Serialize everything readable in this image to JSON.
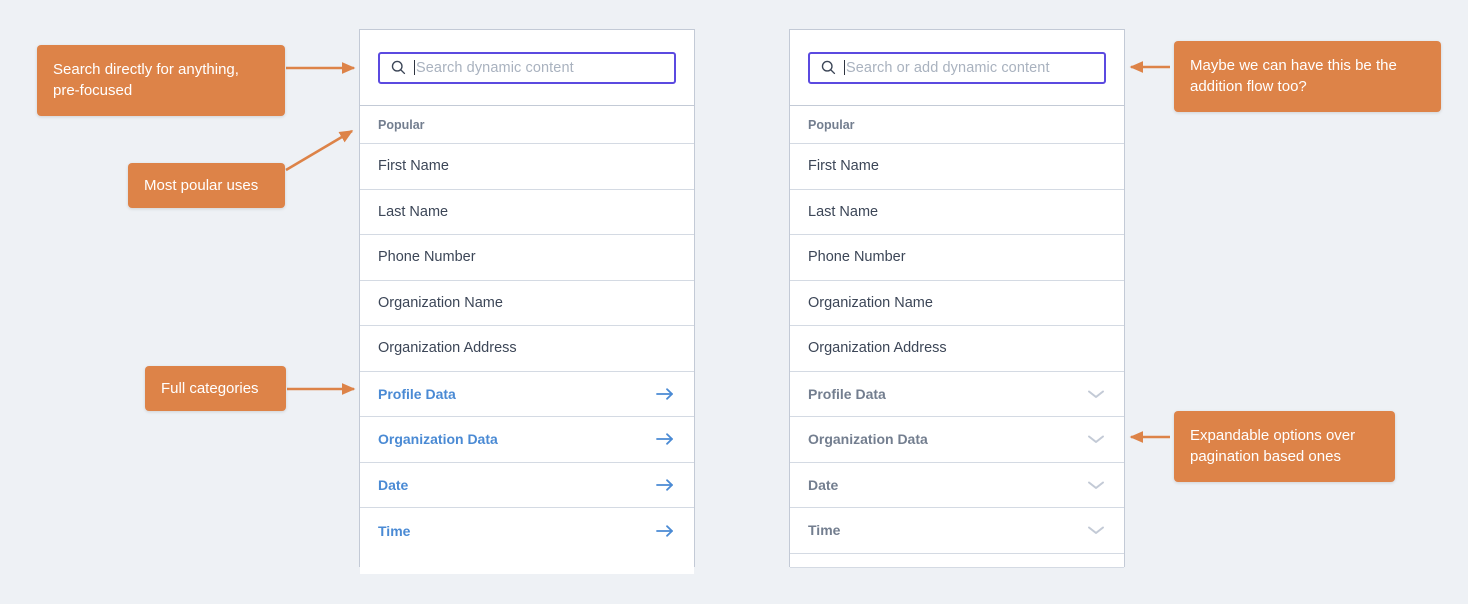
{
  "background_color": "#eef1f5",
  "accent_colors": {
    "note_background": "#dd8348",
    "note_text": "#ffffff",
    "search_border_focus": "#5b4ae0",
    "category_link": "#4a8ad4",
    "category_plain": "#737e8f",
    "row_text": "#3c4657",
    "panel_border": "#c3cad6",
    "chevron": "#c3cad6"
  },
  "panels": [
    {
      "id": "left",
      "search": {
        "icon": "search-icon",
        "placeholder": "Search dynamic content",
        "value": "",
        "focused": true,
        "caret_visible": true
      },
      "section_label": "Popular",
      "popular_items": [
        {
          "label": "First Name"
        },
        {
          "label": "Last Name"
        },
        {
          "label": "Phone Number"
        },
        {
          "label": "Organization Name"
        },
        {
          "label": "Organization Address"
        }
      ],
      "category_items": [
        {
          "label": "Profile Data",
          "icon": "arrow-right-icon"
        },
        {
          "label": "Organization Data",
          "icon": "arrow-right-icon"
        },
        {
          "label": "Date",
          "icon": "arrow-right-icon"
        },
        {
          "label": "Time",
          "icon": "arrow-right-icon"
        }
      ]
    },
    {
      "id": "right",
      "search": {
        "icon": "search-icon",
        "placeholder": "Search or add dynamic content",
        "value": "",
        "focused": true,
        "caret_visible": true
      },
      "section_label": "Popular",
      "popular_items": [
        {
          "label": "First Name"
        },
        {
          "label": "Last Name"
        },
        {
          "label": "Phone Number"
        },
        {
          "label": "Organization Name"
        },
        {
          "label": "Organization Address"
        }
      ],
      "category_items": [
        {
          "label": "Profile Data",
          "icon": "chevron-down-icon"
        },
        {
          "label": "Organization Data",
          "icon": "chevron-down-icon"
        },
        {
          "label": "Date",
          "icon": "chevron-down-icon"
        },
        {
          "label": "Time",
          "icon": "chevron-down-icon"
        }
      ]
    }
  ],
  "annotations": [
    {
      "id": "search",
      "text": "Search directly for anything, pre-focused"
    },
    {
      "id": "popular",
      "text": "Most poular uses"
    },
    {
      "id": "categories",
      "text": "Full categories"
    },
    {
      "id": "addition",
      "text": "Maybe we can have this be the addition flow too?"
    },
    {
      "id": "expandable",
      "text": "Expandable options over pagination based ones"
    }
  ]
}
